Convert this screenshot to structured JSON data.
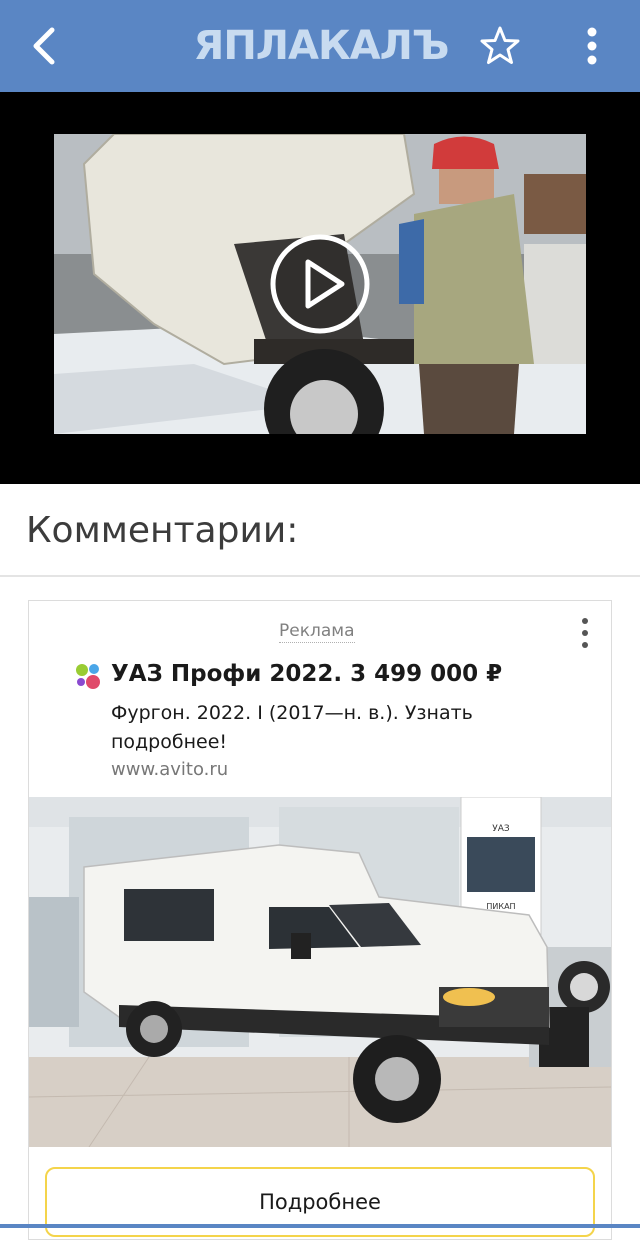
{
  "header": {
    "logo_text": "ЯПЛАКАЛЪ",
    "bg_color": "#5a86c4",
    "icons": [
      "back-arrow-icon",
      "star-outline-icon",
      "vertical-dots-icon"
    ]
  },
  "video": {
    "state": "paused",
    "icon": "play-circle-icon"
  },
  "comments": {
    "title": "Комментарии:"
  },
  "ad": {
    "label": "Реклама",
    "favicon": "avito-dots-icon",
    "title": "УАЗ Профи 2022. 3 499 000 ₽",
    "description": "Фургон. 2022. I (2017—н. в.). Узнать подробнее!",
    "domain": "www.avito.ru",
    "button_label": "Подробнее",
    "button_border_color": "#f4d44b",
    "image_texts": {
      "brand": "УАЗ",
      "poster_caption": "ПИКАП"
    }
  }
}
